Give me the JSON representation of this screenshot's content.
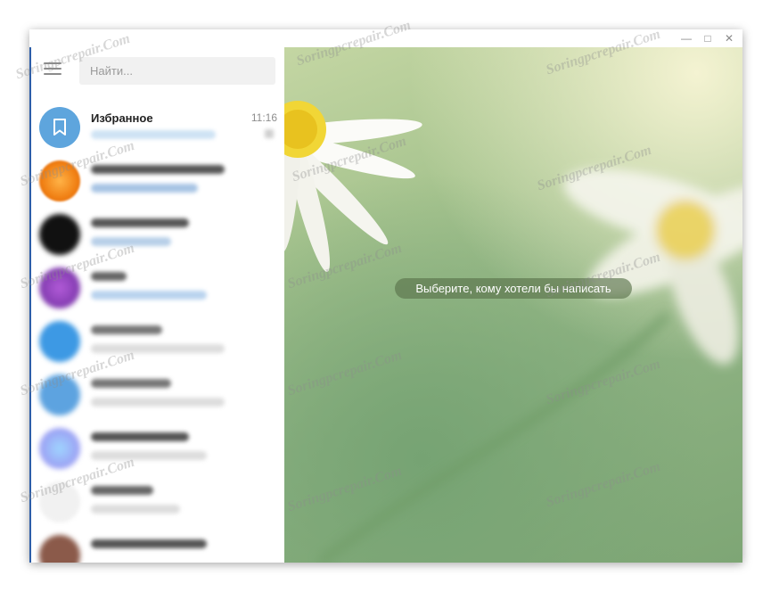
{
  "window": {
    "controls": {
      "minimize": "—",
      "maximize": "□",
      "close": "✕"
    }
  },
  "sidebar": {
    "menu_icon": "hamburger-menu-icon",
    "search": {
      "placeholder": "Найти...",
      "value": ""
    },
    "chats": [
      {
        "name": "Избранное",
        "time": "11:16",
        "avatar": "bookmark-icon",
        "avatar_color": "#5ea5dd"
      }
    ]
  },
  "main": {
    "empty_hint": "Выберите, кому хотели бы написать"
  },
  "watermark": "Soringpcrepair.Com",
  "colors": {
    "accent": "#5ea5dd",
    "hint_bg": "#5a734b"
  }
}
